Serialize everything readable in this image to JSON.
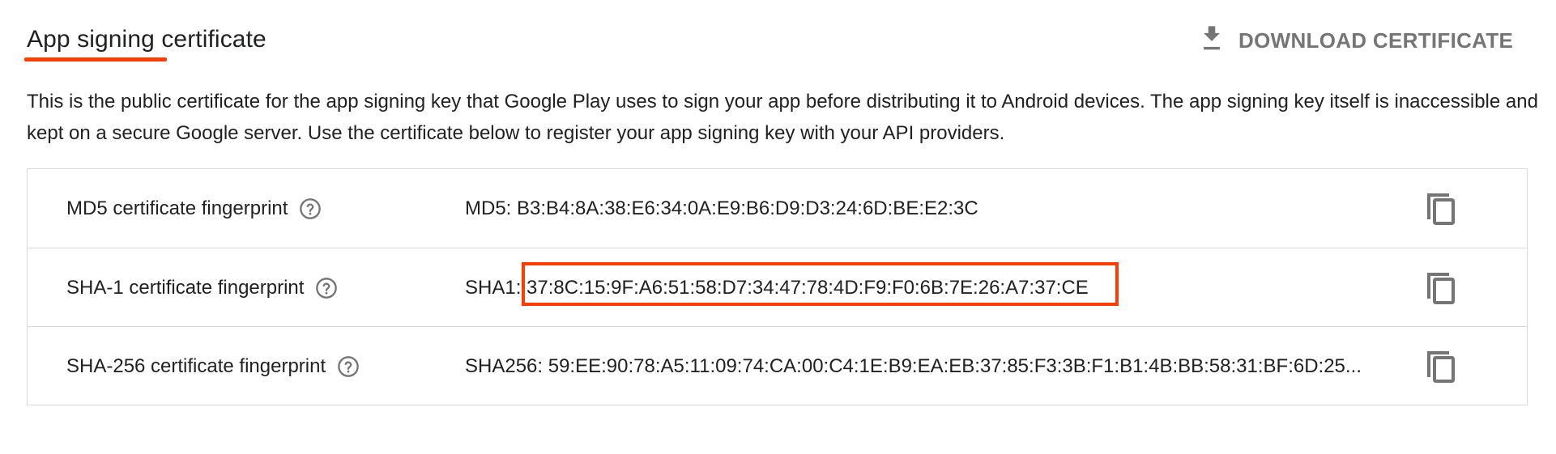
{
  "section": {
    "title": "App signing certificate",
    "download_label": "DOWNLOAD CERTIFICATE",
    "description": "This is the public certificate for the app signing key that Google Play uses to sign your app before distributing it to Android devices. The app signing key itself is inaccessible and kept on a secure Google server. Use the certificate below to register your app signing key with your API providers."
  },
  "fingerprints": [
    {
      "label": "MD5 certificate fingerprint",
      "value": "MD5: B3:B4:8A:38:E6:34:0A:E9:B6:D9:D3:24:6D:BE:E2:3C"
    },
    {
      "label": "SHA-1 certificate fingerprint",
      "value": "SHA1: 37:8C:15:9F:A6:51:58:D7:34:47:78:4D:F9:F0:6B:7E:26:A7:37:CE"
    },
    {
      "label": "SHA-256 certificate fingerprint",
      "value": "SHA256: 59:EE:90:78:A5:11:09:74:CA:00:C4:1E:B9:EA:EB:37:85:F3:3B:F1:B1:4B:BB:58:31:BF:6D:25..."
    }
  ],
  "icons": {
    "download": "download-icon",
    "help": "help-circle-icon",
    "copy": "copy-icon"
  },
  "colors": {
    "accent": "#ff3c00",
    "muted": "#757575",
    "border": "#dadada",
    "text": "#212121"
  }
}
